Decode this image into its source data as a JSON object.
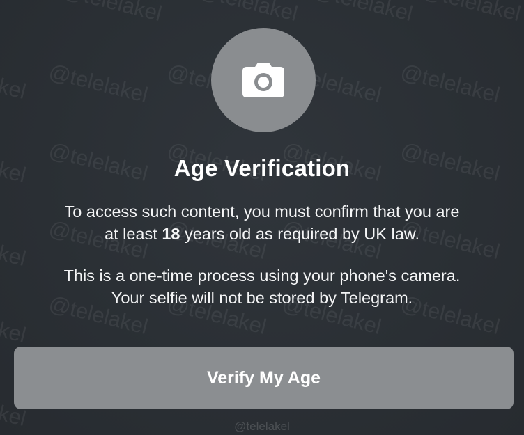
{
  "dialog": {
    "icon": "camera-icon",
    "title": "Age Verification",
    "paragraph1": {
      "line1": "To access such content, you must confirm that you are",
      "line2_prefix": "at least ",
      "line2_bold": "18",
      "line2_suffix": " years old as required by UK law."
    },
    "paragraph2": {
      "line1": "This is a one-time process using your phone's camera.",
      "line2": "Your selfie will not be stored by Telegram."
    },
    "button_label": "Verify My Age"
  },
  "watermark": {
    "text": "@telelakel",
    "footer": "@telelakel"
  },
  "colors": {
    "background": "#2b3035",
    "avatar": "#8a8d90",
    "button": "#8b8e91",
    "text": "#ffffff"
  }
}
